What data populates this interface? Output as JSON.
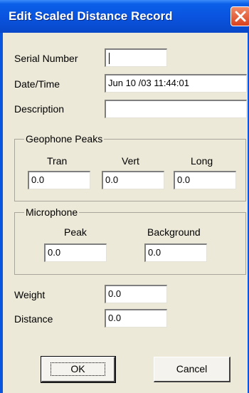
{
  "window": {
    "title": "Edit Scaled Distance Record"
  },
  "fields": {
    "serial_number": {
      "label": "Serial Number",
      "value": ""
    },
    "date_time": {
      "label": "Date/Time",
      "value": "Jun 10 /03 11:44:01"
    },
    "description": {
      "label": "Description",
      "value": ""
    }
  },
  "geophone": {
    "title": "Geophone Peaks",
    "tran": {
      "label": "Tran",
      "value": "0.0"
    },
    "vert": {
      "label": "Vert",
      "value": "0.0"
    },
    "long": {
      "label": "Long",
      "value": "0.0"
    }
  },
  "microphone": {
    "title": "Microphone",
    "peak": {
      "label": "Peak",
      "value": "0.0"
    },
    "background": {
      "label": "Background",
      "value": "0.0"
    }
  },
  "weight": {
    "label": "Weight",
    "value": "0.0"
  },
  "distance": {
    "label": "Distance",
    "value": "0.0"
  },
  "buttons": {
    "ok": "OK",
    "cancel": "Cancel"
  }
}
